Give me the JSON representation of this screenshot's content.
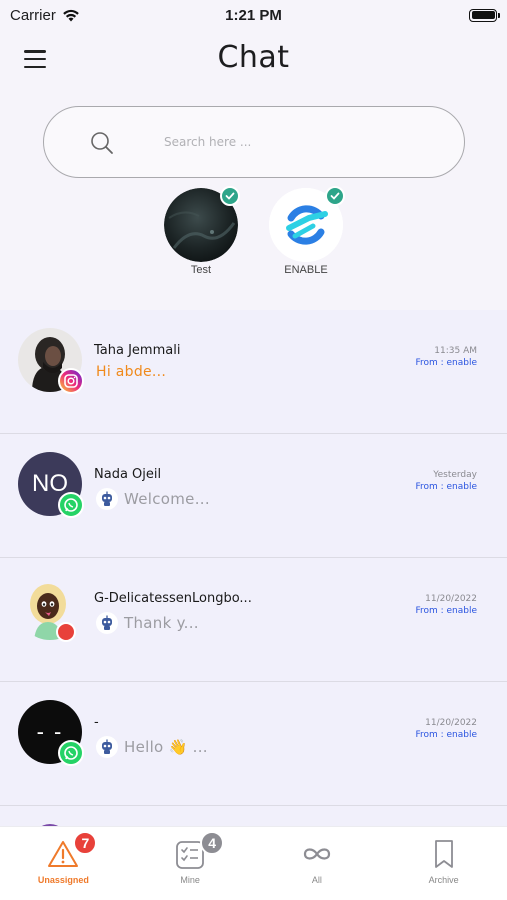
{
  "status_bar": {
    "carrier": "Carrier",
    "time": "1:21 PM"
  },
  "header": {
    "title": "Chat"
  },
  "search": {
    "placeholder": "Search here ..."
  },
  "accounts": [
    {
      "label": "Test"
    },
    {
      "label": "ENABLE"
    }
  ],
  "chats": [
    {
      "name": "Taha Jemmali",
      "preview": "Hi abde...",
      "time": "11:35 AM",
      "from": "From : enable",
      "channel": "instagram",
      "unread": true
    },
    {
      "name": "Nada Ojeil",
      "initials": "NO",
      "preview": "Welcome...",
      "time": "Yesterday",
      "from": "From : enable",
      "channel": "whatsapp"
    },
    {
      "name": "G-DelicatessenLongbo...",
      "preview": "Thank y...",
      "time": "11/20/2022",
      "from": "From : enable",
      "channel": "other"
    },
    {
      "name": "-",
      "initials": "- -",
      "preview": "Hello 👋 ...",
      "time": "11/20/2022",
      "from": "From : enable",
      "channel": "whatsapp"
    }
  ],
  "tabs": [
    {
      "label": "Unassigned",
      "badge": "7",
      "active": true
    },
    {
      "label": "Mine",
      "badge": "4"
    },
    {
      "label": "All"
    },
    {
      "label": "Archive"
    }
  ],
  "colors": {
    "accent": "#ef7a2b",
    "badge_red": "#e8413a",
    "badge_grey": "#8d8d93",
    "link_blue": "#2b55e0",
    "check_green": "#2ea58a"
  }
}
